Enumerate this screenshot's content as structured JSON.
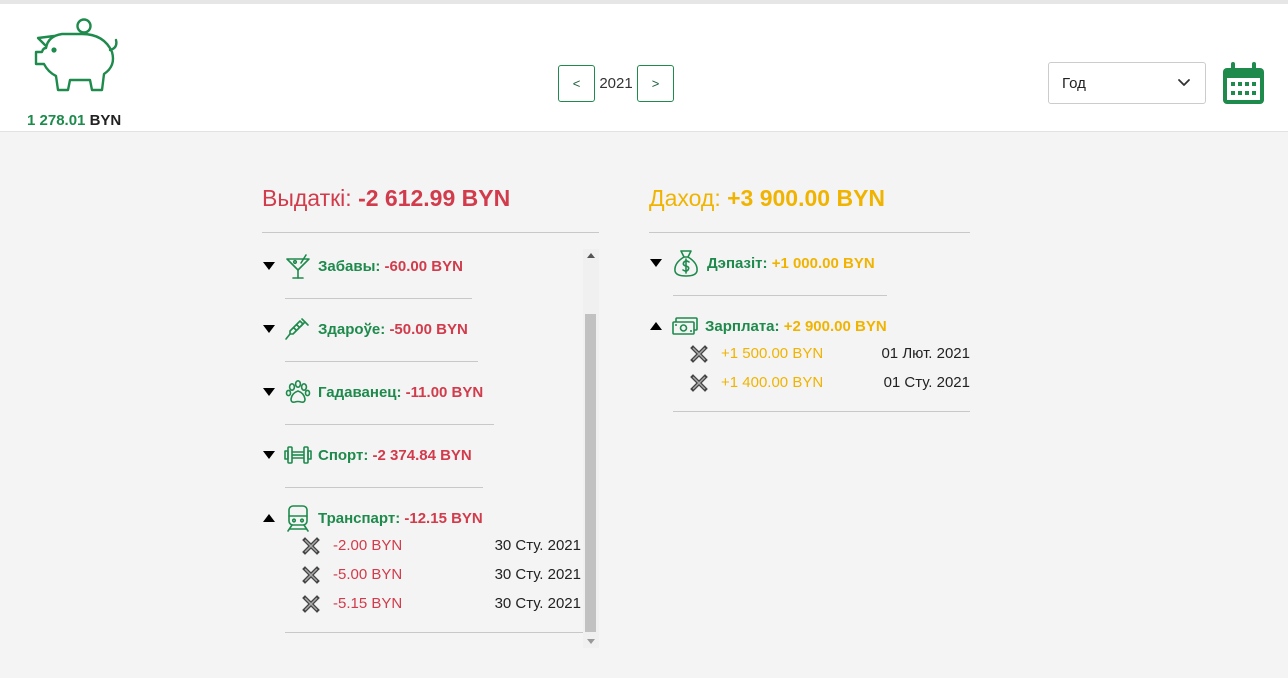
{
  "header": {
    "balance_amount": "1 278.01",
    "balance_currency": "BYN",
    "year": "2021",
    "prev_label": "<",
    "next_label": ">",
    "period_selected": "Год"
  },
  "expenses": {
    "label": "Выдаткі:",
    "total": "-2 612.99 BYN",
    "categories": [
      {
        "name": "Забавы: ",
        "amount": "-60.00 BYN",
        "icon": "cocktail-icon",
        "expanded": false
      },
      {
        "name": "Здароўе: ",
        "amount": "-50.00 BYN",
        "icon": "syringe-icon",
        "expanded": false
      },
      {
        "name": "Гадаванец: ",
        "amount": "-11.00 BYN",
        "icon": "paw-icon",
        "expanded": false
      },
      {
        "name": "Спорт: ",
        "amount": "-2 374.84 BYN",
        "icon": "dumbbell-icon",
        "expanded": false
      },
      {
        "name": "Транспарт: ",
        "amount": "-12.15 BYN",
        "icon": "train-icon",
        "expanded": true,
        "entries": [
          {
            "amount": "-2.00 BYN",
            "date": "30 Сту. 2021"
          },
          {
            "amount": "-5.00 BYN",
            "date": "30 Сту. 2021"
          },
          {
            "amount": "-5.15 BYN",
            "date": "30 Сту. 2021"
          }
        ]
      }
    ]
  },
  "income": {
    "label": "Даход:",
    "total": "+3 900.00 BYN",
    "categories": [
      {
        "name": "Дэпазіт: ",
        "amount": "+1 000.00 BYN",
        "icon": "money-bag-icon",
        "expanded": false
      },
      {
        "name": "Зарплата: ",
        "amount": "+2 900.00 BYN",
        "icon": "cash-icon",
        "expanded": true,
        "entries": [
          {
            "amount": "+1 500.00 BYN",
            "date": "01 Лют. 2021"
          },
          {
            "amount": "+1 400.00 BYN",
            "date": "01 Сту. 2021"
          }
        ]
      }
    ]
  },
  "colors": {
    "brand_green": "#1e8a4c",
    "expense_red": "#d13b4b",
    "income_yellow": "#f0b400"
  }
}
